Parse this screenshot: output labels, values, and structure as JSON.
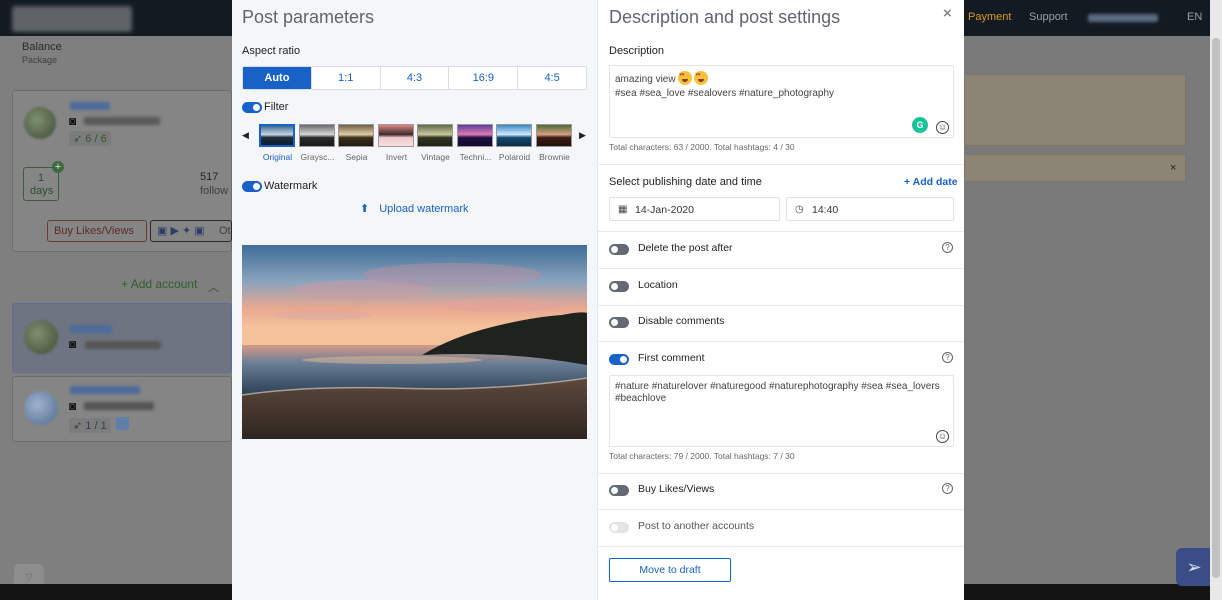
{
  "background": {
    "nav": {
      "payment": "Payment",
      "support": "Support",
      "lang": "EN"
    },
    "balance": {
      "title": "Balance",
      "subtitle": "Package"
    },
    "stats": {
      "days_value": "1",
      "days_label": "days",
      "followers_value": "517",
      "followers_label": "follow"
    },
    "buttons": {
      "buy_likes": "Buy Likes/Views",
      "other": "Ot"
    },
    "add_account": "Add account",
    "account_badges": {
      "first": "6 / 6",
      "third": "1 / 1"
    }
  },
  "post_parameters": {
    "title": "Post parameters",
    "aspect_ratio_label": "Aspect ratio",
    "aspect_ratios": [
      "Auto",
      "1:1",
      "4:3",
      "16:9",
      "4:5"
    ],
    "aspect_selected": "Auto",
    "filter_label": "Filter",
    "filter_enabled": true,
    "filters": [
      "Original",
      "Graysc...",
      "Sepia",
      "Invert",
      "Vintage",
      "Techni...",
      "Polaroid",
      "Brownie"
    ],
    "filter_selected": "Original",
    "watermark_label": "Watermark",
    "watermark_enabled": true,
    "upload_watermark": "Upload watermark"
  },
  "description_settings": {
    "title": "Description and post settings",
    "description_label": "Description",
    "description_line1": "amazing view",
    "description_line2": "#sea #sea_love #sealovers #nature_photography",
    "description_counter": "Total characters: 63 / 2000. Total hashtags: 4 / 30",
    "publish_label": "Select publishing date and time",
    "add_date": "+ Add date",
    "date_value": "14-Jan-2020",
    "time_value": "14:40",
    "options": [
      {
        "label": "Delete the post after",
        "enabled": false,
        "help": true
      },
      {
        "label": "Location",
        "enabled": false,
        "help": false
      },
      {
        "label": "Disable comments",
        "enabled": false,
        "help": false
      },
      {
        "label": "First comment",
        "enabled": true,
        "help": true
      }
    ],
    "first_comment_text": "#nature #naturelover #naturegood #naturephotography #sea #sea_lovers #beachlove",
    "comment_counter": "Total characters: 79 / 2000. Total hashtags: 7 / 30",
    "buy_likes_label": "Buy Likes/Views",
    "post_to_other_label": "Post to another accounts",
    "move_to_draft": "Move to draft"
  },
  "colors": {
    "accent": "#1761c7",
    "topbar": "#121a22",
    "payment": "#d89a1c"
  }
}
